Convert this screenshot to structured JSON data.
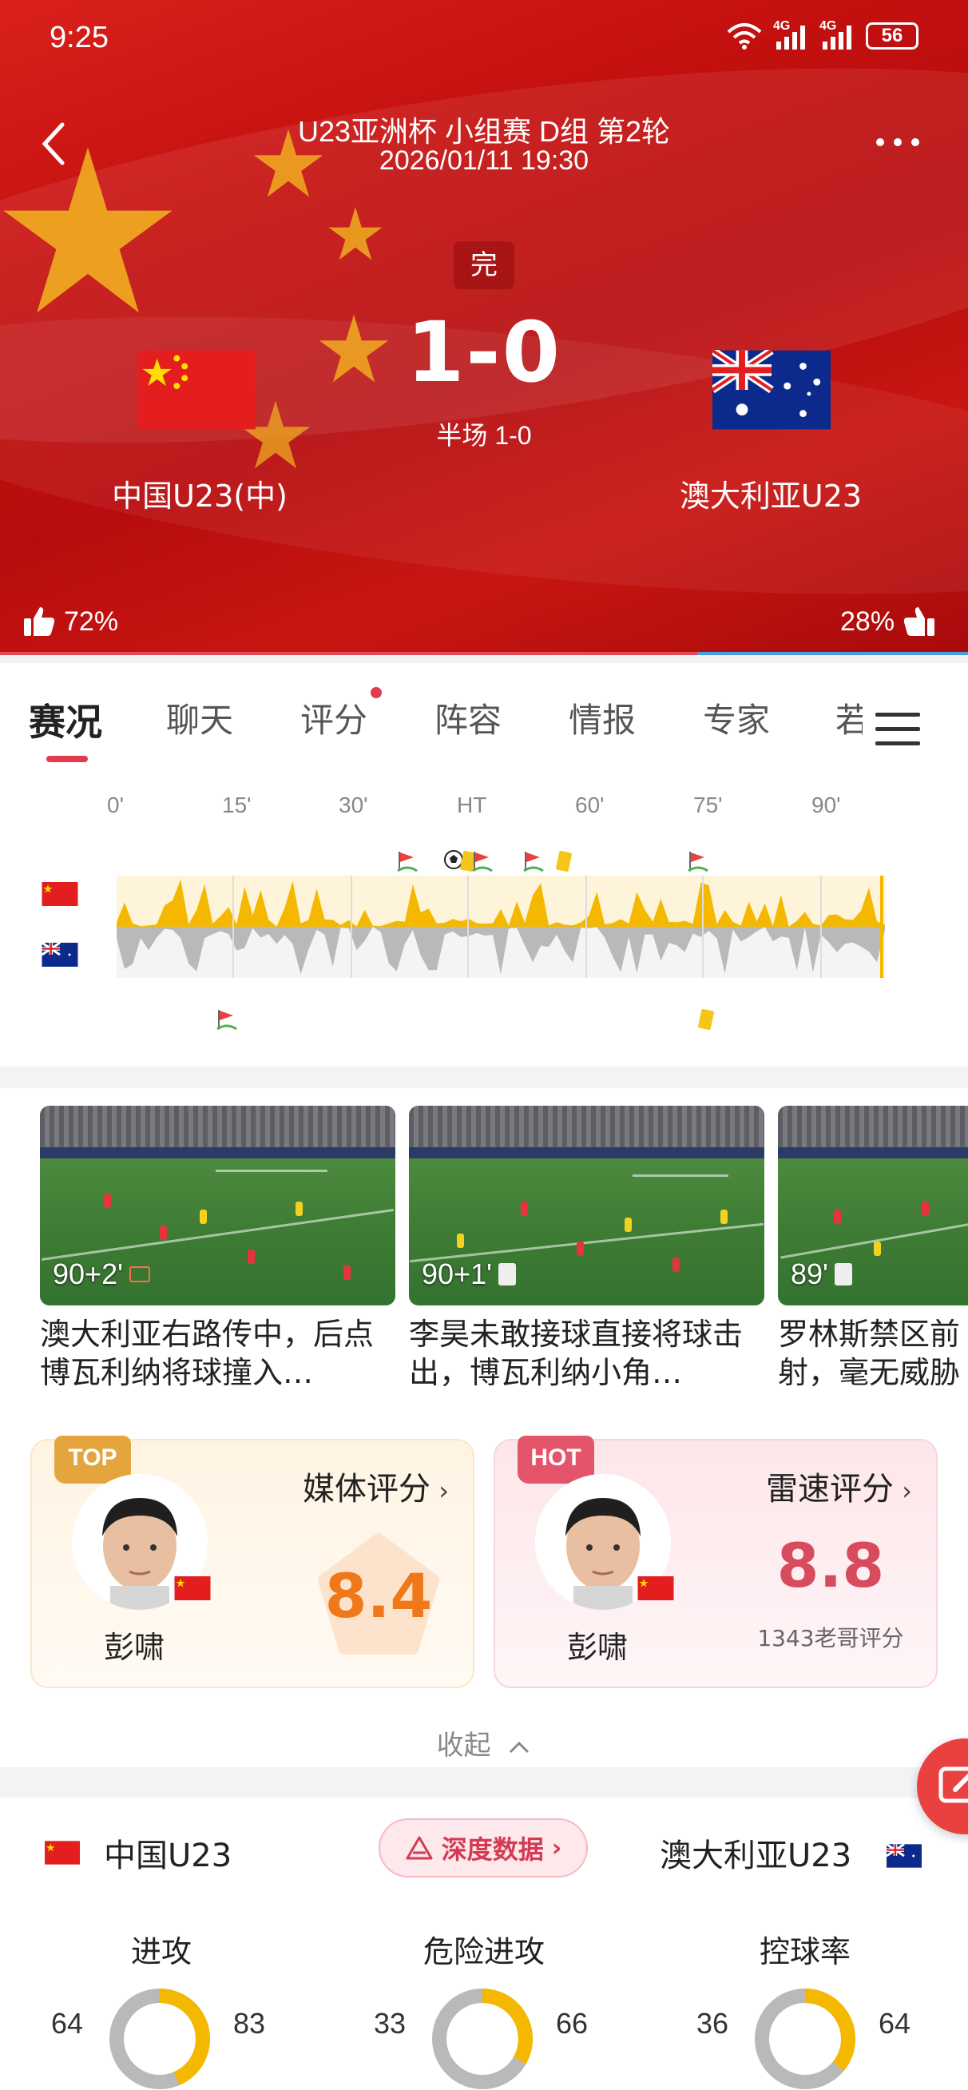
{
  "status_bar": {
    "time": "9:25",
    "signal_1": "4G",
    "signal_2": "4G",
    "battery": "56"
  },
  "header": {
    "competition": "U23亚洲杯 小组赛 D组 第2轮",
    "datetime": "2026/01/11 19:30",
    "status": "完",
    "score": "1-0",
    "halftime": "半场 1-0",
    "home_team": "中国U23(中)",
    "away_team": "澳大利亚U23",
    "home_support": "72%",
    "away_support": "28%",
    "home_support_fraction": 0.72
  },
  "tabs": [
    {
      "label": "赛况",
      "active": true
    },
    {
      "label": "聊天"
    },
    {
      "label": "评分",
      "dot": true
    },
    {
      "label": "阵容"
    },
    {
      "label": "情报"
    },
    {
      "label": "专家"
    },
    {
      "label": "若"
    }
  ],
  "timeline": {
    "ticks": [
      "0'",
      "15'",
      "30'",
      "HT",
      "60'",
      "75'",
      "90'"
    ],
    "home_color": "#f5b800",
    "away_color": "#b9b9b9"
  },
  "highlights": [
    {
      "time": "90+2'",
      "icon": "video-icon",
      "title": "澳大利亚右路传中，后点博瓦利纳将球撞入…"
    },
    {
      "time": "90+1'",
      "icon": "note-icon",
      "title": "李昊未敢接球直接将球击出，博瓦利纳小角…"
    },
    {
      "time": "89'",
      "icon": "note-icon",
      "title": "罗林斯禁区前射，毫无威胁"
    }
  ],
  "ratings": {
    "media": {
      "badge": "TOP",
      "title": "媒体评分",
      "player": "彭啸",
      "score": "8.4"
    },
    "fast": {
      "badge": "HOT",
      "title": "雷速评分",
      "player": "彭啸",
      "score": "8.8",
      "count": "1343老哥评分"
    },
    "collapse_label": "收起"
  },
  "stats": {
    "home_team": "中国U23",
    "away_team": "澳大利亚U23",
    "deep_data": "深度数据",
    "items": [
      {
        "label": "进攻",
        "home": "64",
        "away": "83",
        "home_value": 64,
        "away_value": 83
      },
      {
        "label": "危险进攻",
        "home": "33",
        "away": "66",
        "home_value": 33,
        "away_value": 66
      },
      {
        "label": "控球率",
        "home": "36",
        "away": "64",
        "home_value": 36,
        "away_value": 64
      }
    ]
  },
  "colors": {
    "brand_red": "#d9201c",
    "home": "#f5b800",
    "away": "#b9b9b9",
    "accent_orange": "#f07818",
    "accent_pink": "#d84a5e"
  }
}
